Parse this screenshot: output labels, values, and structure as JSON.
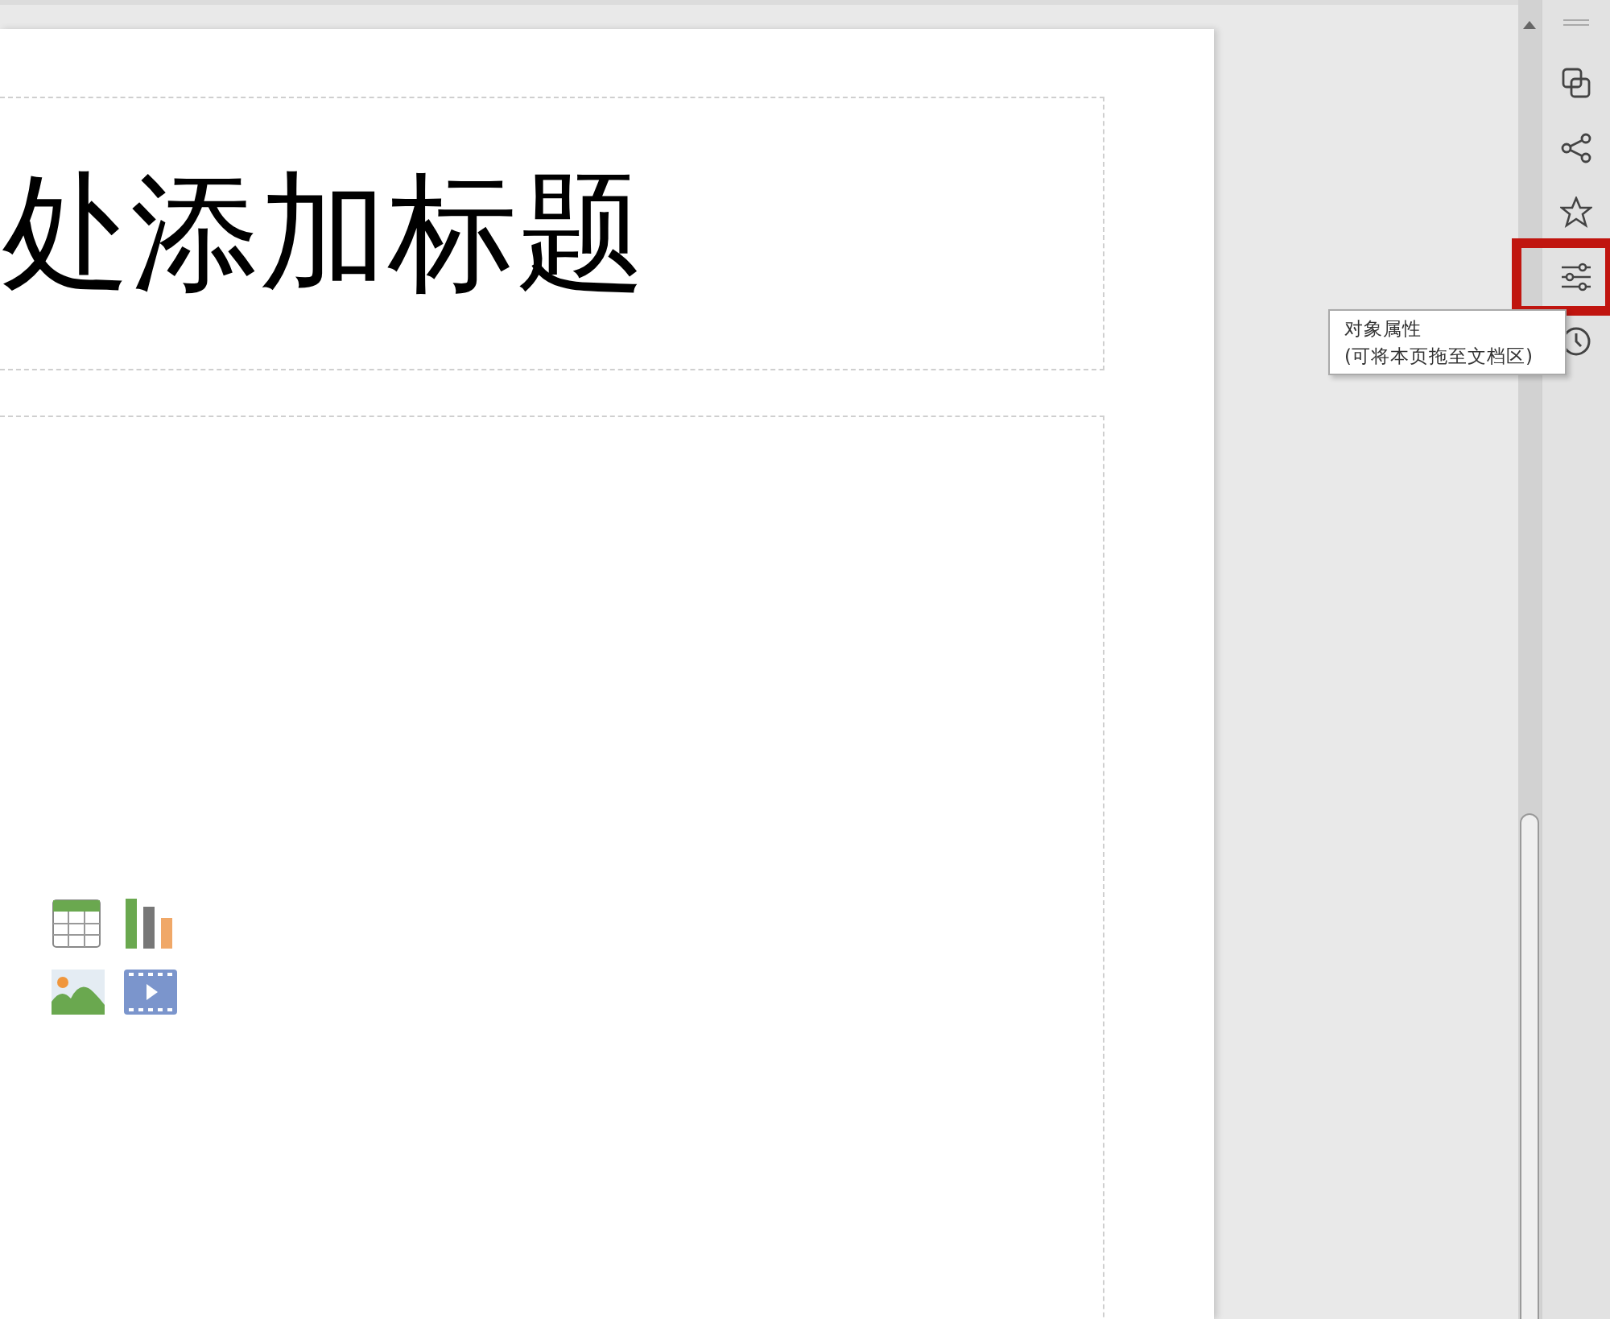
{
  "slide": {
    "title": "处添加标题",
    "insert_icons": [
      {
        "kind": "table"
      },
      {
        "kind": "chart"
      },
      {
        "kind": "image"
      },
      {
        "kind": "video"
      }
    ]
  },
  "sidebar": {
    "items": [
      {
        "kind": "copy",
        "highlighted": false
      },
      {
        "kind": "share",
        "highlighted": false
      },
      {
        "kind": "star",
        "highlighted": false
      },
      {
        "kind": "sliders",
        "highlighted": true
      },
      {
        "kind": "clock",
        "highlighted": false
      }
    ]
  },
  "tooltip": {
    "title": "对象属性",
    "hint": "(可将本页拖至文档区)"
  }
}
